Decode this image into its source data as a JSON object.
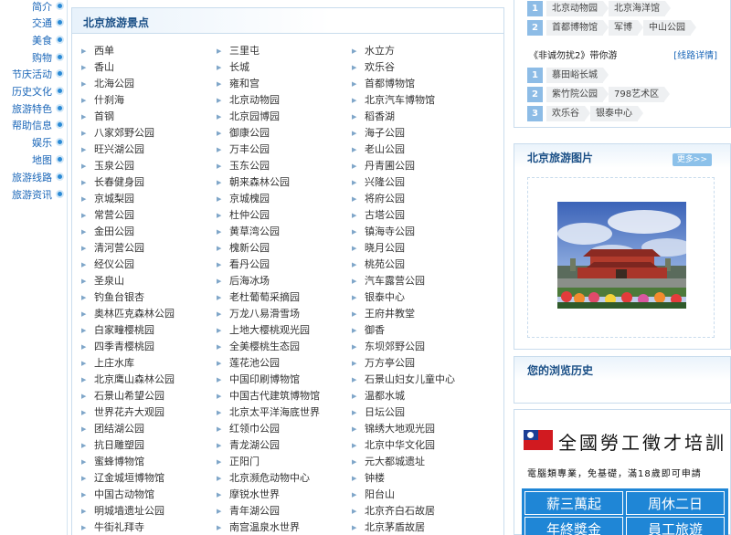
{
  "nav": {
    "items": [
      "简介",
      "交通",
      "美食",
      "购物",
      "节庆活动",
      "历史文化",
      "旅游特色",
      "帮助信息",
      "娱乐",
      "地图",
      "旅游线路",
      "旅游资讯"
    ]
  },
  "main": {
    "title": "北京旅游景点",
    "columns": [
      [
        "西单",
        "香山",
        "北海公园",
        "什刹海",
        "首钢",
        "八家郊野公园",
        "旺兴湖公园",
        "玉泉公园",
        "长春健身园",
        "京城梨园",
        "常营公园",
        "金田公园",
        "清河营公园",
        "经仪公园",
        "圣泉山",
        "钓鱼台银杏",
        "奥林匹克森林公园",
        "白家疃樱桃园",
        "四季青樱桃园",
        "上庄水库",
        "北京鹰山森林公园",
        "石景山希望公园",
        "世界花卉大观园",
        "团结湖公园",
        "抗日雕塑园",
        "蜜蜂博物馆",
        "辽金城垣博物馆",
        "中国古动物馆",
        "明城墙遗址公园",
        "牛街礼拜寺"
      ],
      [
        "三里屯",
        "长城",
        "雍和宫",
        "北京动物园",
        "北京园博园",
        "御康公园",
        "万丰公园",
        "玉东公园",
        "朝来森林公园",
        "京城槐园",
        "杜仲公园",
        "黄草湾公园",
        "槐新公园",
        "看丹公园",
        "后海冰场",
        "老杜葡萄采摘园",
        "万龙八易滑雪场",
        "上地大樱桃观光园",
        "全美樱桃生态园",
        "莲花池公园",
        "中国印刷博物馆",
        "中国古代建筑博物馆",
        "北京太平洋海底世界",
        "红领巾公园",
        "青龙湖公园",
        "正阳门",
        "北京濒危动物中心",
        "摩锐水世界",
        "青年湖公园",
        "南宫温泉水世界"
      ],
      [
        "水立方",
        "欢乐谷",
        "首都博物馆",
        "北京汽车博物馆",
        "稻香湖",
        "海子公园",
        "老山公园",
        "丹青圃公园",
        "兴隆公园",
        "将府公园",
        "古塔公园",
        "镇海寺公园",
        "晓月公园",
        "桃苑公园",
        "汽车露营公园",
        "银泰中心",
        "王府井教堂",
        "御香",
        "东坝郊野公园",
        "万方亭公园",
        "石景山妇女儿童中心",
        "温都水城",
        "日坛公园",
        "锦绣大地观光园",
        "北京中华文化园",
        "元大都城遗址",
        "钟楼",
        "阳台山",
        "北京齐白石故居",
        "北京茅盾故居"
      ]
    ]
  },
  "routes": {
    "top_rows": [
      [
        "北京动物园",
        "北京海洋馆"
      ],
      [
        "首都博物馆",
        "军博",
        "中山公园"
      ]
    ],
    "top_numbers": [
      "1",
      "2"
    ],
    "featured_title": "《非诚勿扰2》带你游",
    "featured_detail": "[线路详情]",
    "featured_rows": [
      {
        "num": "1",
        "tags": [
          "慕田峪长城"
        ]
      },
      {
        "num": "2",
        "tags": [
          "紫竹院公园",
          "798艺术区"
        ]
      },
      {
        "num": "3",
        "tags": [
          "欢乐谷",
          "银泰中心"
        ]
      }
    ]
  },
  "photos": {
    "title": "北京旅游图片",
    "more_label": "更多>>"
  },
  "history": {
    "title": "您的浏览历史"
  },
  "ad": {
    "title": "全國勞工徵才培訓",
    "subtitle": "電腦類專業，免基礎，滿18歲即可申請",
    "cells": [
      "薪三萬起",
      "周休二日",
      "年終獎金",
      "員工旅遊"
    ]
  },
  "colors": {
    "accent": "#1a4f86",
    "link": "#1a66b8",
    "nav_dot": "#2a8ad6",
    "route_num": "#8dbce6"
  }
}
